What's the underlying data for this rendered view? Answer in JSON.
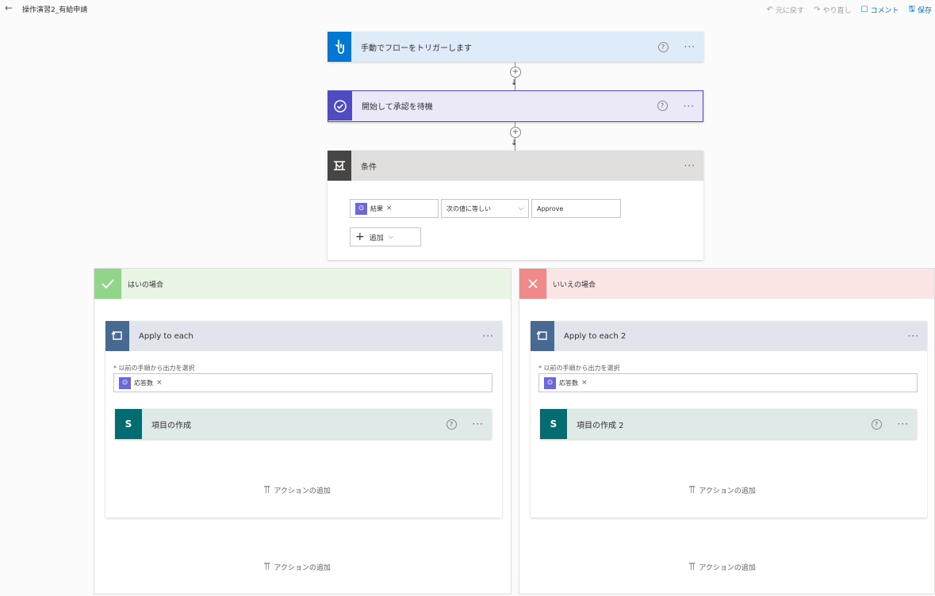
{
  "topbar": {
    "back_icon": "←",
    "flow_name": "操作演習2_有給申請",
    "actions": [
      {
        "icon": "↶",
        "label": "元に戻す"
      },
      {
        "icon": "↷",
        "label": "やり直し"
      },
      {
        "icon": "☐",
        "label": "コメント"
      },
      {
        "icon": "🖫",
        "label": "保存"
      }
    ]
  },
  "trigger": {
    "title": "手動でフローをトリガーします",
    "help": "?",
    "more": "···",
    "icon": "hand-icon",
    "color": "#0078d4"
  },
  "approval": {
    "title": "開始して承認を待機",
    "help": "?",
    "more": "···",
    "icon": "approval-icon",
    "color": "#4f4cc3"
  },
  "condition": {
    "title": "条件",
    "more": "···",
    "icon": "condition-icon",
    "color": "#484644",
    "left_token": "結果",
    "operator": "次の値に等しい",
    "value": "Approve",
    "add_label": "追加",
    "add_icon": "+",
    "chevron": "⌵"
  },
  "yes_branch": {
    "title": "はいの場合",
    "color": "#92d48a",
    "loop": {
      "title": "Apply to each",
      "more": "···",
      "field_label": "* 以前の手順から出力を選択",
      "token": "応答数",
      "action": {
        "title": "項目の作成",
        "help": "?",
        "more": "···",
        "icon_text": "S"
      },
      "add_action": "アクションの追加"
    },
    "add_action": "アクションの追加"
  },
  "no_branch": {
    "title": "いいえの場合",
    "color": "#f08a8a",
    "loop": {
      "title": "Apply to each 2",
      "more": "···",
      "field_label": "* 以前の手順から出力を選択",
      "token": "応答数",
      "action": {
        "title": "項目の作成 2",
        "help": "?",
        "more": "···",
        "icon_text": "S"
      },
      "add_action": "アクションの追加"
    },
    "add_action": "アクションの追加"
  },
  "token_x": "×",
  "connector_plus": "+",
  "connector_arrow": "↓"
}
